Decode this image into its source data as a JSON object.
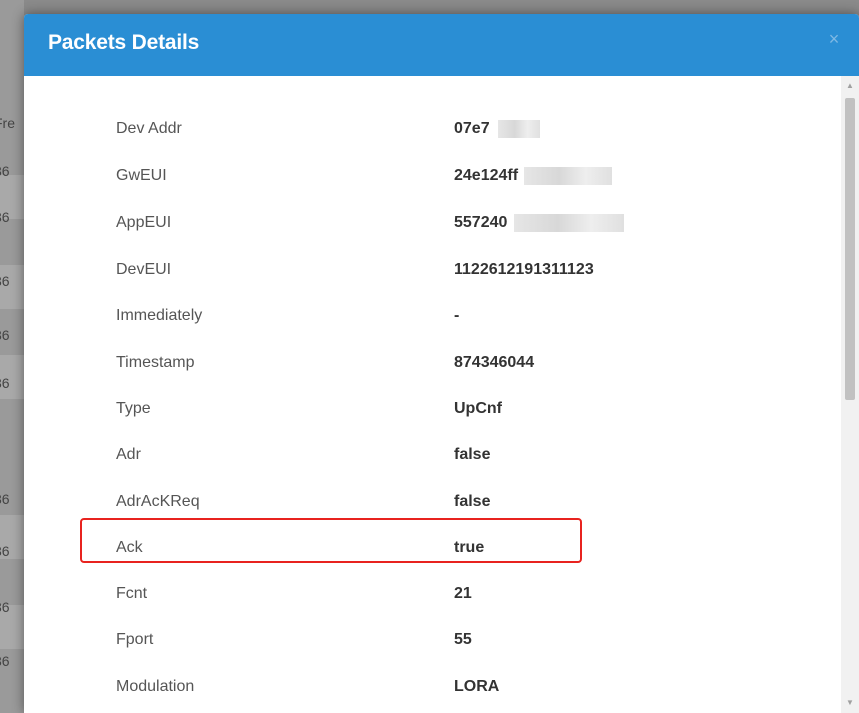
{
  "background": {
    "fragments": [
      "Fre",
      "36",
      "36",
      "36",
      "36",
      "36",
      "36",
      "36",
      "36",
      "36"
    ]
  },
  "modal": {
    "title": "Packets Details",
    "close_label": "×",
    "rows": [
      {
        "label": "Dev Addr",
        "value": "07e7"
      },
      {
        "label": "GwEUI",
        "value": "24e124ff"
      },
      {
        "label": "AppEUI",
        "value": "557240"
      },
      {
        "label": "DevEUI",
        "value": "1122612191311123"
      },
      {
        "label": "Immediately",
        "value": "-"
      },
      {
        "label": "Timestamp",
        "value": "874346044"
      },
      {
        "label": "Type",
        "value": "UpCnf"
      },
      {
        "label": "Adr",
        "value": "false"
      },
      {
        "label": "AdrAcKReq",
        "value": "false"
      },
      {
        "label": "Ack",
        "value": "true"
      },
      {
        "label": "Fcnt",
        "value": "21"
      },
      {
        "label": "Fport",
        "value": "55"
      },
      {
        "label": "Modulation",
        "value": "LORA"
      }
    ]
  },
  "scrollbar": {
    "up_arrow": "▲",
    "down_arrow": "▼"
  },
  "colors": {
    "header": "#2a8ed4",
    "highlight": "#e8231f"
  }
}
